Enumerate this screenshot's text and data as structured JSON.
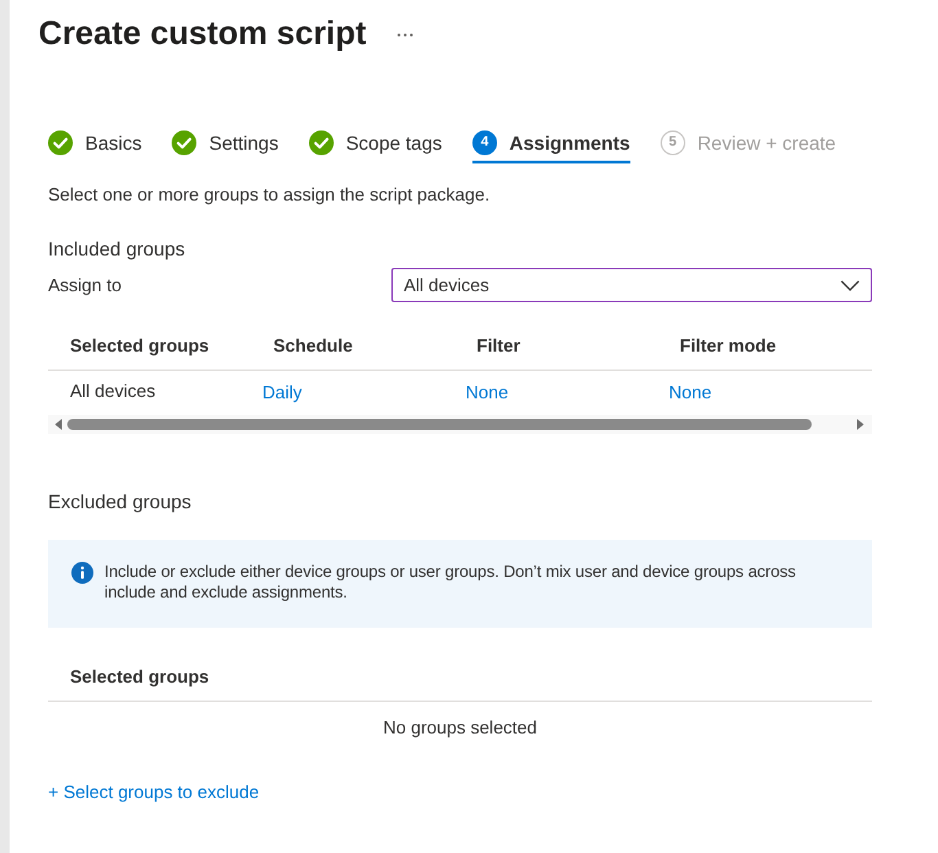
{
  "header": {
    "title": "Create custom script"
  },
  "steps": [
    {
      "label": "Basics",
      "kind": "done",
      "selected": false
    },
    {
      "label": "Settings",
      "kind": "done",
      "selected": false
    },
    {
      "label": "Scope tags",
      "kind": "done",
      "selected": false
    },
    {
      "label": "Assignments",
      "kind": "current",
      "number": "4",
      "selected": true
    },
    {
      "label": "Review + create",
      "kind": "pending",
      "number": "5",
      "selected": false
    }
  ],
  "intro": "Select one or more groups to assign the script package.",
  "included": {
    "heading": "Included groups",
    "assign_label": "Assign to",
    "assign_value": "All devices",
    "assign_focused": true,
    "table": {
      "columns": [
        "Selected groups",
        "Schedule",
        "Filter",
        "Filter mode"
      ],
      "rows": [
        [
          {
            "text": "All devices",
            "kind": "text"
          },
          {
            "text": "Daily",
            "kind": "link"
          },
          {
            "text": "None",
            "kind": "link"
          },
          {
            "text": "None",
            "kind": "link"
          }
        ]
      ]
    }
  },
  "excluded": {
    "heading": "Excluded groups",
    "info": "Include or exclude either device groups or user groups. Don’t mix user and device groups across include and exclude assignments.",
    "table": {
      "columns": [
        "Selected groups"
      ],
      "empty": "No groups selected"
    },
    "add_link": "+ Select groups to exclude"
  }
}
